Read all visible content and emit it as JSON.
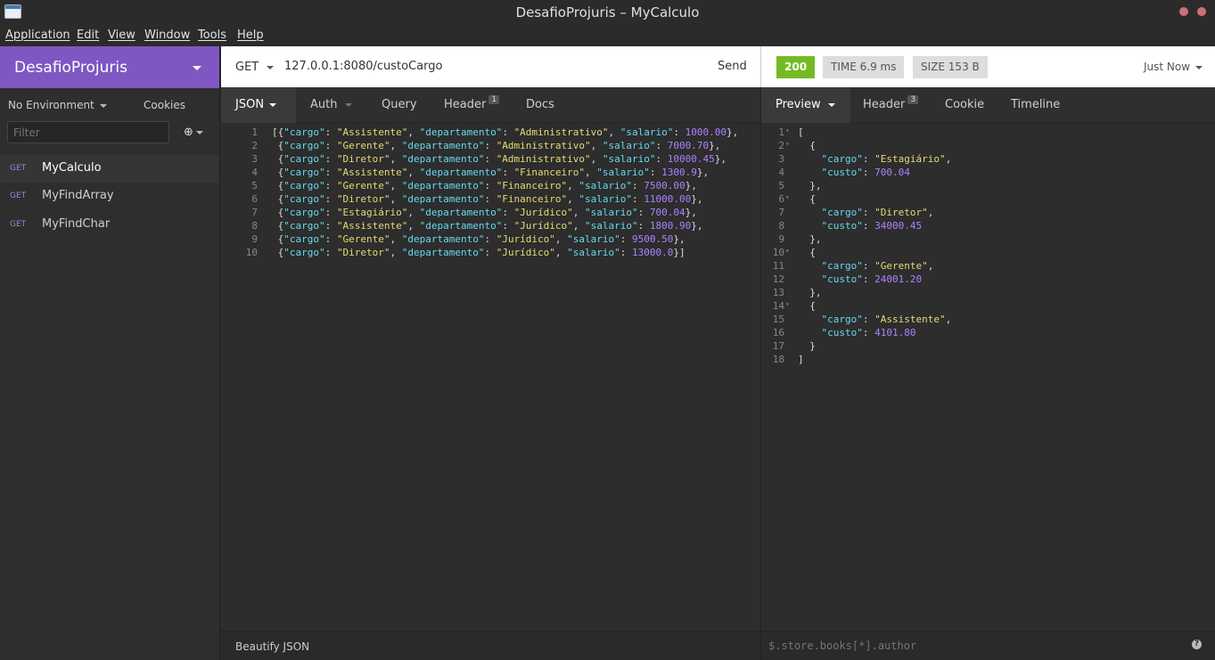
{
  "window": {
    "title": "DesafioProjuris – MyCalculo"
  },
  "menu": [
    "Application",
    "Edit",
    "View",
    "Window",
    "Tools",
    "Help"
  ],
  "sidebar": {
    "workspace": "DesafioProjuris",
    "environment": "No Environment",
    "cookies": "Cookies",
    "filter_placeholder": "Filter",
    "requests": [
      {
        "method": "GET",
        "name": "MyCalculo"
      },
      {
        "method": "GET",
        "name": "MyFindArray"
      },
      {
        "method": "GET",
        "name": "MyFindChar"
      }
    ]
  },
  "request": {
    "method": "GET",
    "url": "127.0.0.1:8080/custoCargo",
    "send": "Send",
    "tabs": [
      {
        "label": "JSON"
      },
      {
        "label": "Auth"
      },
      {
        "label": "Query"
      },
      {
        "label": "Header",
        "count": "1"
      },
      {
        "label": "Docs"
      }
    ],
    "body_lines": [
      "[{\"cargo\": \"Assistente\", \"departamento\": \"Administrativo\", \"salario\": 1000.00},",
      " {\"cargo\": \"Gerente\", \"departamento\": \"Administrativo\", \"salario\": 7000.70},",
      " {\"cargo\": \"Diretor\", \"departamento\": \"Administrativo\", \"salario\": 10000.45},",
      " {\"cargo\": \"Assistente\", \"departamento\": \"Financeiro\", \"salario\": 1300.9},",
      " {\"cargo\": \"Gerente\", \"departamento\": \"Financeiro\", \"salario\": 7500.00},",
      " {\"cargo\": \"Diretor\", \"departamento\": \"Financeiro\", \"salario\": 11000.00},",
      " {\"cargo\": \"Estagiário\", \"departamento\": \"Jurídico\", \"salario\": 700.04},",
      " {\"cargo\": \"Assistente\", \"departamento\": \"Jurídico\", \"salario\": 1800.90},",
      " {\"cargo\": \"Gerente\", \"departamento\": \"Jurídico\", \"salario\": 9500.50},",
      " {\"cargo\": \"Diretor\", \"departamento\": \"Jurídico\", \"salario\": 13000.0}]"
    ],
    "footer": "Beautify JSON"
  },
  "response": {
    "status": "200",
    "time_label": "TIME",
    "time_value": "6.9 ms",
    "size_label": "SIZE",
    "size_value": "153 B",
    "when": "Just Now",
    "tabs": [
      {
        "label": "Preview"
      },
      {
        "label": "Header",
        "count": "3"
      },
      {
        "label": "Cookie"
      },
      {
        "label": "Timeline"
      }
    ],
    "body_lines": [
      "[",
      "  {",
      "    \"cargo\": \"Estagiário\",",
      "    \"custo\": 700.04",
      "  },",
      "  {",
      "    \"cargo\": \"Diretor\",",
      "    \"custo\": 34000.45",
      "  },",
      "  {",
      "    \"cargo\": \"Gerente\",",
      "    \"custo\": 24001.20",
      "  },",
      "  {",
      "    \"cargo\": \"Assistente\",",
      "    \"custo\": 4101.80",
      "  }",
      "]"
    ],
    "filter_placeholder": "$.store.books[*].author",
    "help_icon": "?"
  },
  "colors": {
    "accent": "#7e57c2",
    "status_ok": "#75ba24"
  }
}
